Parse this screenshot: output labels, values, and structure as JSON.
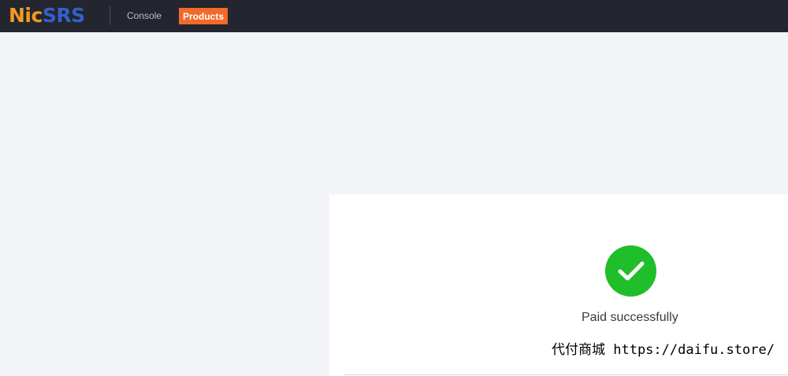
{
  "header": {
    "logo_part1": "Nic",
    "logo_part2": "SRS",
    "nav": {
      "console": "Console",
      "products": "Products"
    }
  },
  "colors": {
    "topbar": "#23262f",
    "accent": "#f26a2b",
    "success": "#1fbe2a",
    "logo_orange": "#f39a21",
    "logo_blue": "#3460c8"
  },
  "result": {
    "icon": "check-circle-icon",
    "message": "Paid successfully"
  },
  "watermark": "代付商城 https://daifu.store/"
}
